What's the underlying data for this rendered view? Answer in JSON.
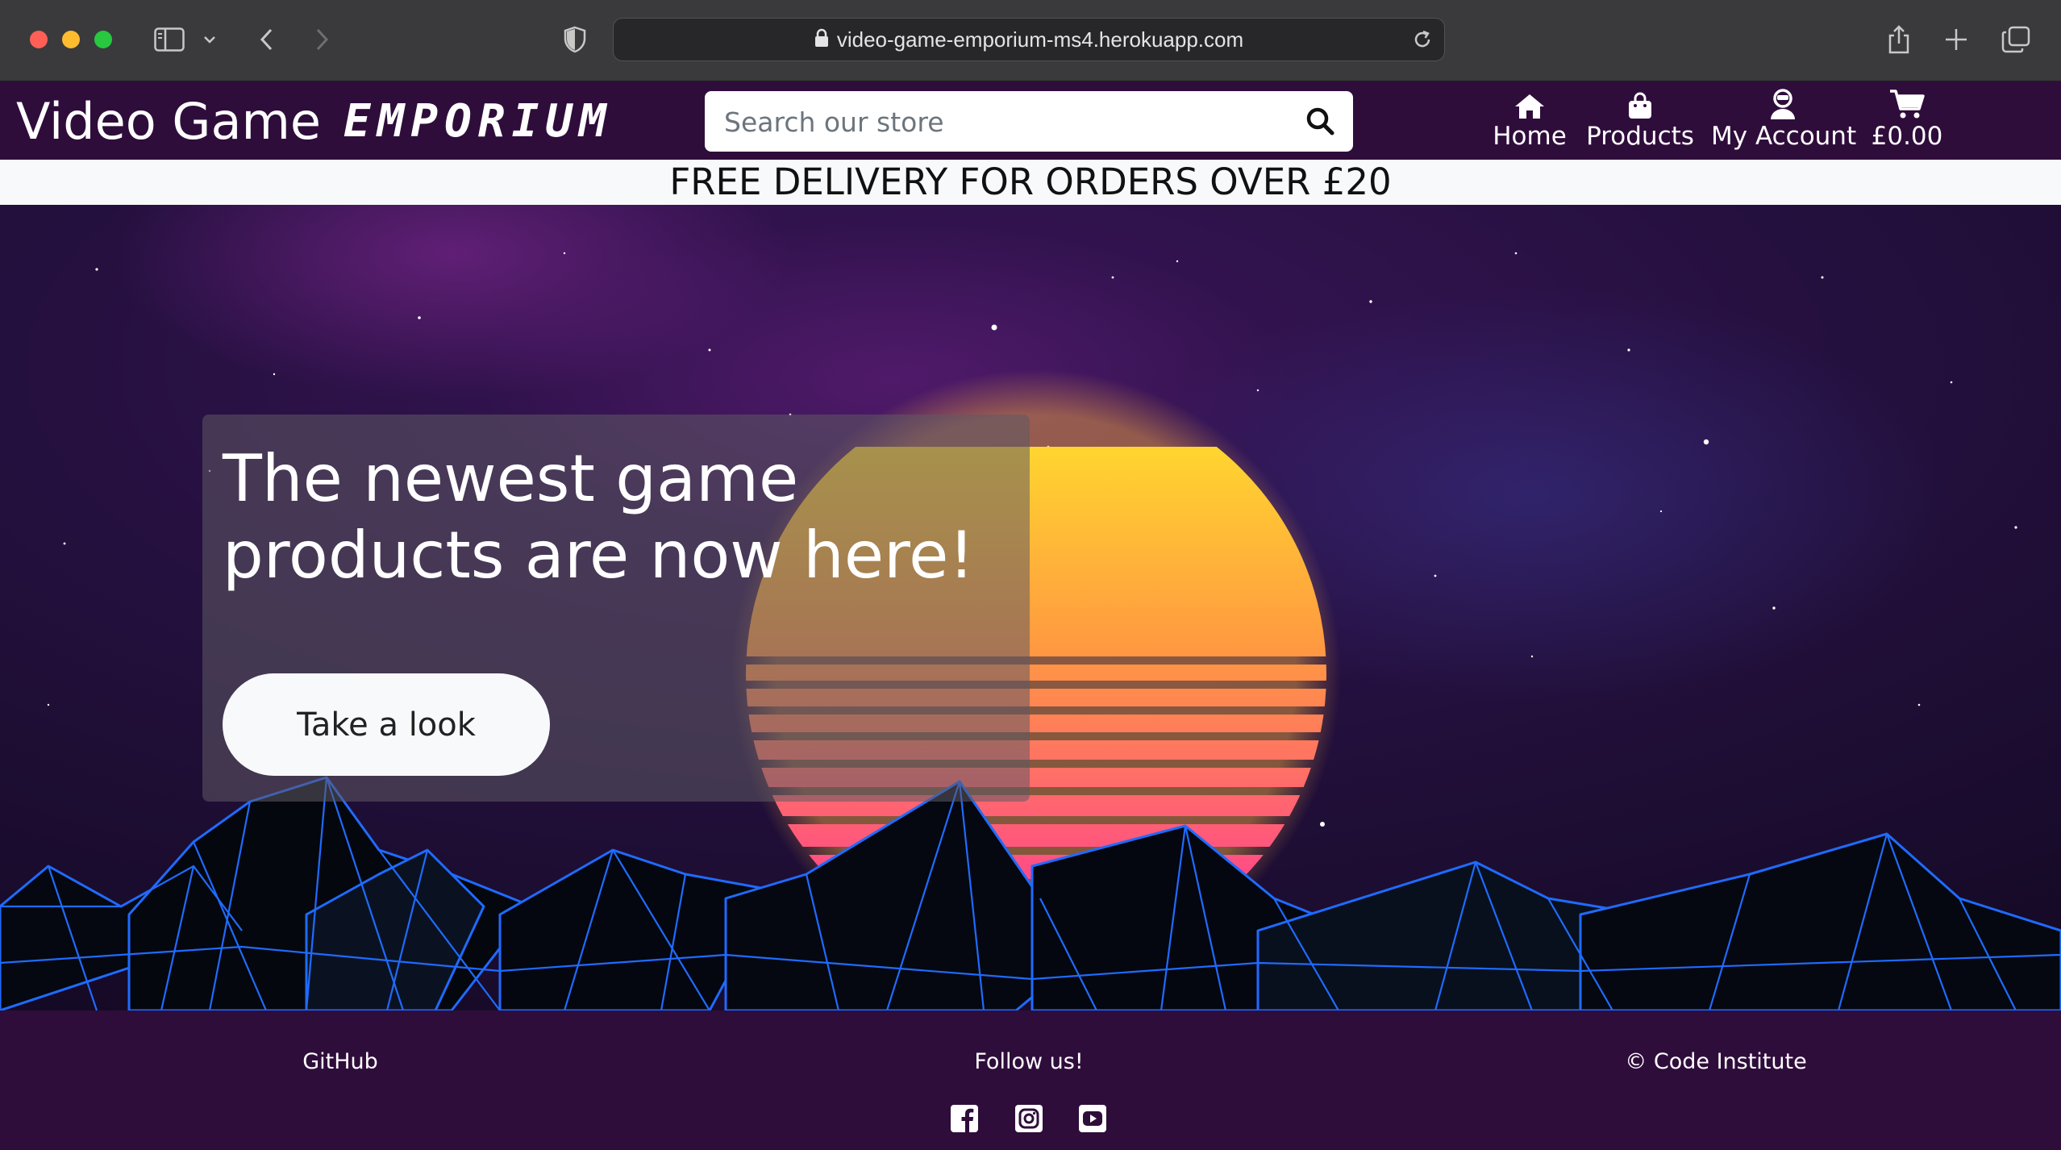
{
  "browser": {
    "url": "video-game-emporium-ms4.herokuapp.com",
    "icons": [
      "sidebar-icon",
      "chevron-down-icon",
      "back-icon",
      "forward-icon",
      "shield-icon",
      "lock-icon",
      "reload-icon",
      "share-icon",
      "new-tab-icon",
      "tabs-overview-icon"
    ]
  },
  "site": {
    "brand_primary": "Video Game",
    "brand_secondary": "EMPORIUM",
    "search_placeholder": "Search our store",
    "nav": [
      {
        "label": "Home",
        "icon": "home-icon"
      },
      {
        "label": "Products",
        "icon": "shopping-bag-icon"
      },
      {
        "label": "My Account",
        "icon": "user-icon"
      },
      {
        "label": "£0.00",
        "icon": "cart-icon"
      }
    ]
  },
  "banner": {
    "text": "FREE DELIVERY FOR ORDERS OVER £20"
  },
  "hero": {
    "title": "The newest game products are now here!",
    "cta_label": "Take a look"
  },
  "footer": {
    "left": "GitHub",
    "center": "Follow us!",
    "right": "© Code Institute",
    "social": [
      "facebook-icon",
      "instagram-icon",
      "youtube-icon"
    ]
  },
  "colors": {
    "nav_bg": "#2f0d3b",
    "banner_bg": "#f8f9fa",
    "sun_top": "#ffe82a",
    "sun_bottom": "#ff2fa0",
    "mountain_edge": "#1f6bff"
  }
}
